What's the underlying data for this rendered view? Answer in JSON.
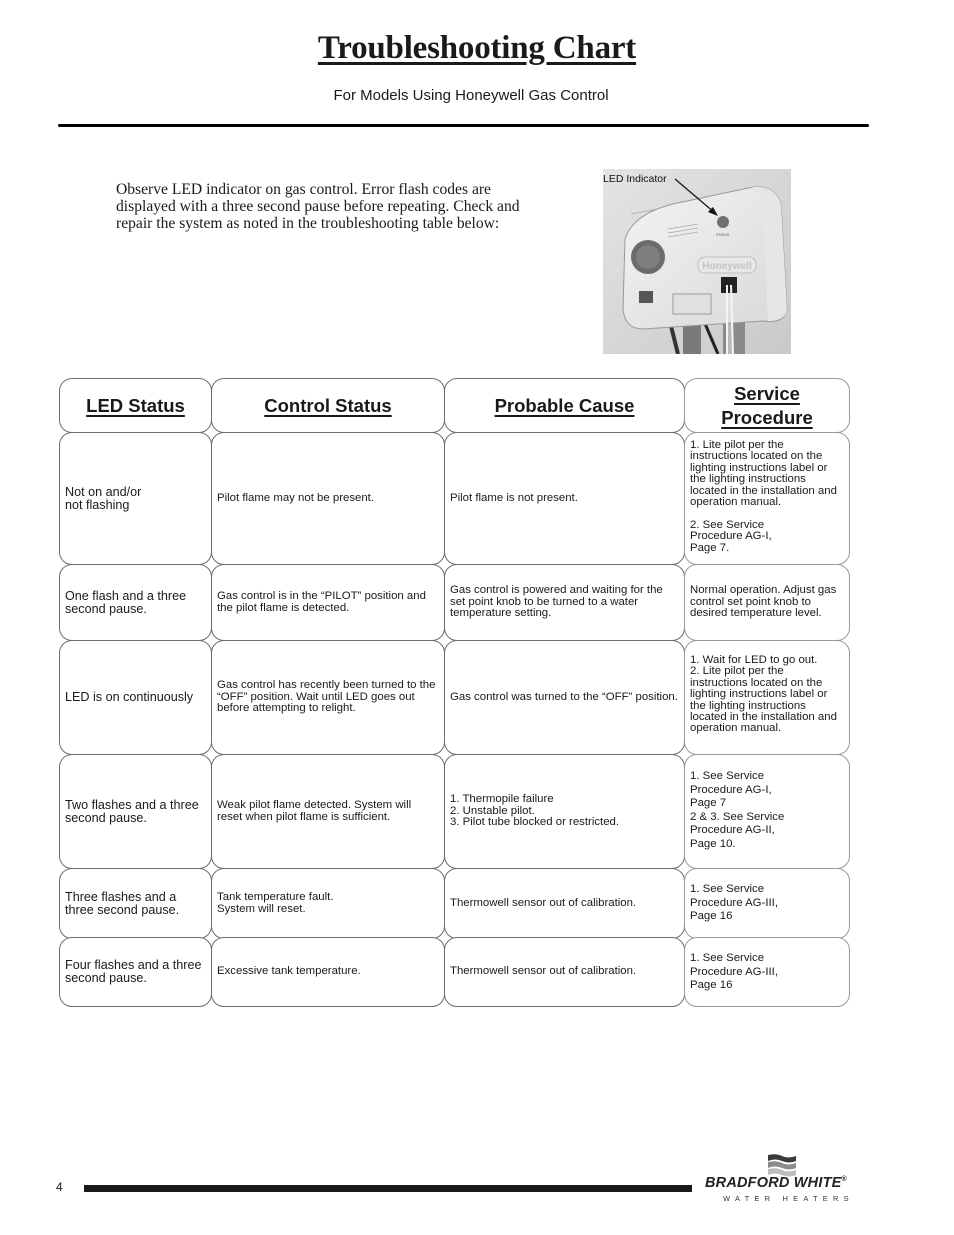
{
  "header": {
    "title": "Troubleshooting Chart",
    "subtitle": "For Models Using Honeywell Gas Control"
  },
  "intro": {
    "text": "Observe LED indicator on gas control.  Error flash codes are displayed with a three second pause before repeating. Check and repair the system as noted in the troubleshooting table below:"
  },
  "photo": {
    "label": "LED Indicator",
    "brand_on_device": "Honeywell",
    "led_label": "STATUS",
    "icon": "gas-control-photo"
  },
  "table": {
    "headers": [
      "LED Status",
      "Control Status",
      "Probable Cause",
      "Service\nProcedure"
    ],
    "rows": [
      {
        "led": "Not on and/or\nnot flashing",
        "control": "Pilot flame may not be present.",
        "cause": "Pilot flame is not present.",
        "procedure": "1. Lite pilot per the instructions located on the lighting instructions label or the lighting instructions located in the installation and operation manual.\n\n2. See Service\n   Procedure AG-I,\n   Page 7."
      },
      {
        "led": "One flash and a three second pause.",
        "control": "Gas control is in the “PILOT” position and the pilot flame is detected.",
        "cause": "Gas control is powered and waiting for the set point knob to be turned to a water temperature setting.",
        "procedure": "Normal operation. Adjust gas control set point knob to desired temperature level."
      },
      {
        "led": "LED is on continuously",
        "control": "Gas control has recently been turned to the “OFF” position.  Wait until LED goes out before attempting to relight.",
        "cause": "Gas control was turned to the “OFF” position.",
        "procedure": "1. Wait for LED to go out.\n2. Lite pilot per the instructions located on the lighting instructions label or the lighting instructions located in the installation and operation manual."
      },
      {
        "led": "Two flashes and a three second pause.",
        "control": "Weak pilot flame detected. System will reset when pilot flame is sufficient.",
        "cause": "1. Thermopile failure\n2. Unstable pilot.\n3. Pilot tube blocked or restricted.",
        "procedure": "1. See Service\n   Procedure AG-I,\n   Page 7\n2 & 3. See Service\n   Procedure AG-II,\n   Page 10."
      },
      {
        "led": "Three flashes and a three second pause.",
        "control": "Tank temperature fault.\nSystem will reset.",
        "cause": "Thermowell sensor out of calibration.",
        "procedure": "1. See Service\n   Procedure AG-III,\n   Page 16"
      },
      {
        "led": "Four flashes and a three second pause.",
        "control": "Excessive tank temperature.",
        "cause": "Thermowell sensor out of calibration.",
        "procedure": "1. See Service\n   Procedure AG-III,\n   Page 16"
      }
    ]
  },
  "footer": {
    "page_number": "4",
    "brand": "BRADFORD WHITE",
    "brand_mark": "®",
    "brand_sub": "WATER HEATERS"
  }
}
